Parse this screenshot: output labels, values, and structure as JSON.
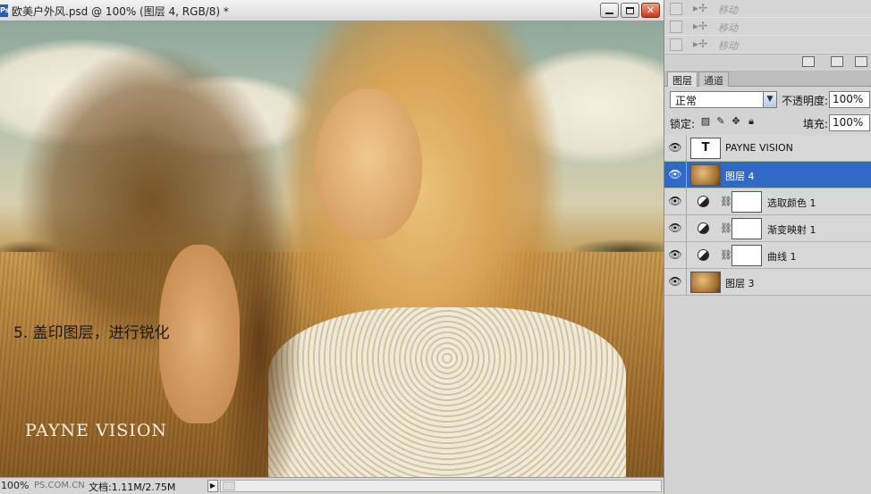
{
  "document": {
    "ps_icon": "Ps",
    "title": "欧美户外风.psd @ 100% (图层 4, RGB/8) *",
    "caption": "5. 盖印图层，进行锐化",
    "watermark": "PAYNE VISION"
  },
  "window_controls": {
    "minimize_icon": "minimize-icon",
    "maximize_icon": "maximize-icon",
    "close_icon": "close-icon",
    "close_glyph": "✕"
  },
  "statusbar": {
    "zoom": "100%",
    "brand": "PS.COM.CN",
    "doc_size": "文档:1.11M/2.75M",
    "arrow": "▶"
  },
  "history": {
    "items": [
      {
        "label": "移动",
        "icon": "move-icon"
      },
      {
        "label": "移动",
        "icon": "move-icon"
      },
      {
        "label": "移动",
        "icon": "move-icon"
      }
    ]
  },
  "layers_panel": {
    "tabs": [
      {
        "label": "图层",
        "active": true
      },
      {
        "label": "通道",
        "active": false
      }
    ],
    "blend_mode": "正常",
    "opacity_label": "不透明度:",
    "opacity": "100%",
    "lock_label": "锁定:",
    "fill_label": "填充:",
    "fill": "100%",
    "layers": [
      {
        "name": "PAYNE VISION",
        "kind": "text",
        "thumb_glyph": "T",
        "selected": false
      },
      {
        "name": "图层 4",
        "kind": "pixel",
        "selected": true
      },
      {
        "name": "选取颜色 1",
        "kind": "adjustment",
        "selected": false
      },
      {
        "name": "渐变映射 1",
        "kind": "adjustment",
        "selected": false
      },
      {
        "name": "曲线 1",
        "kind": "adjustment",
        "selected": false
      },
      {
        "name": "图层 3",
        "kind": "pixel",
        "selected": false
      }
    ]
  },
  "colors": {
    "selection": "#3169c6",
    "panel_bg": "#d3d3d3"
  }
}
